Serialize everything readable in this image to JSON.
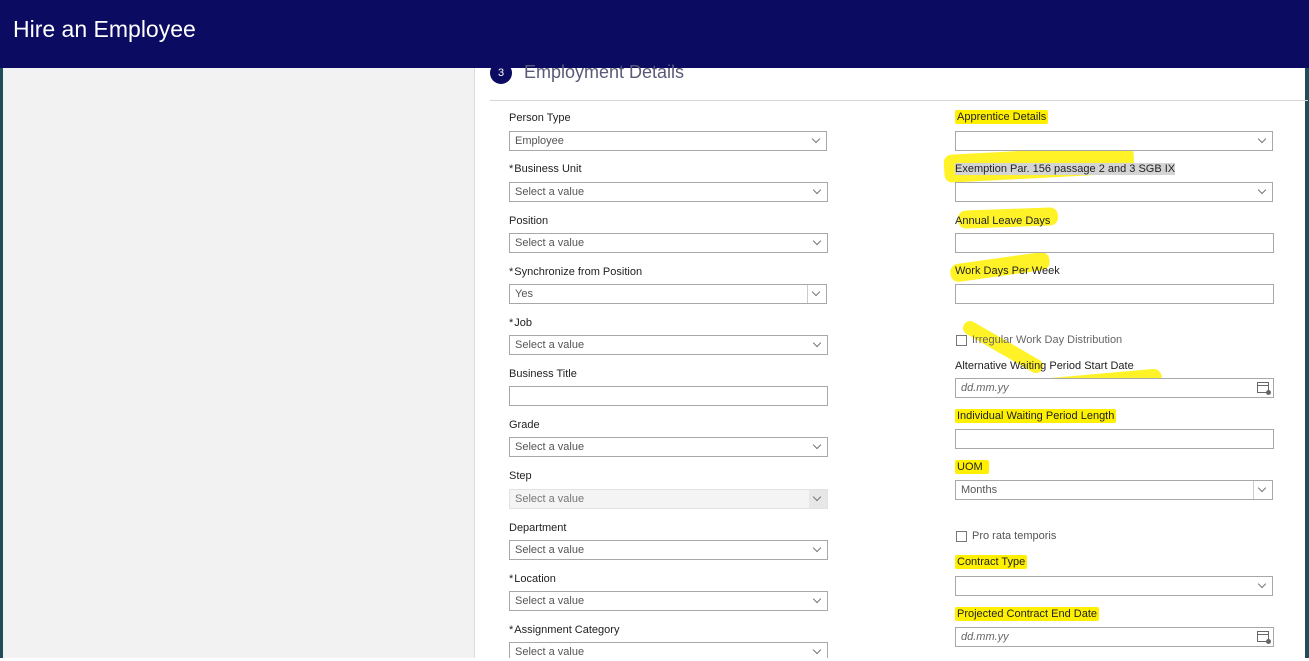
{
  "header": {
    "title": "Hire an Employee"
  },
  "section": {
    "step": "3",
    "title": "Employment Details"
  },
  "left_fields": {
    "person_type": {
      "label": "Person Type",
      "value": "Employee"
    },
    "business_unit": {
      "label": "Business Unit",
      "value": "Select a value"
    },
    "position": {
      "label": "Position",
      "value": "Select a value"
    },
    "sync_position": {
      "label": "Synchronize from Position",
      "value": "Yes"
    },
    "job": {
      "label": "Job",
      "value": "Select a value"
    },
    "business_title": {
      "label": "Business Title",
      "value": ""
    },
    "grade": {
      "label": "Grade",
      "value": "Select a value"
    },
    "step": {
      "label": "Step",
      "value": "Select a value"
    },
    "department": {
      "label": "Department",
      "value": "Select a value"
    },
    "location": {
      "label": "Location",
      "value": "Select a value"
    },
    "assignment_category": {
      "label": "Assignment Category",
      "value": "Select a value"
    }
  },
  "right_fields": {
    "apprentice_details": {
      "label": "Apprentice Details",
      "value": ""
    },
    "exemption": {
      "label": "Exemption Par. 156 passage 2 and 3 SGB IX",
      "value": ""
    },
    "annual_leave_days": {
      "label": "Annual Leave Days",
      "value": ""
    },
    "work_days_per_week": {
      "label": "Work Days Per Week",
      "value": ""
    },
    "irregular_distribution": {
      "label": "Irregular Work Day Distribution"
    },
    "alt_waiting_start": {
      "label": "Alternative Waiting Period Start Date",
      "placeholder": "dd.mm.yy"
    },
    "waiting_length": {
      "label": "Individual Waiting Period Length",
      "value": ""
    },
    "uom": {
      "label": "UOM",
      "value": "Months"
    },
    "pro_rata": {
      "label": "Pro rata temporis"
    },
    "contract_type": {
      "label": "Contract Type",
      "value": ""
    },
    "projected_end_date": {
      "label": "Projected Contract End Date",
      "placeholder": "dd.mm.yy"
    }
  },
  "required_marker": "*",
  "colors": {
    "header": "#0b0b61",
    "highlight": "#fff000"
  }
}
